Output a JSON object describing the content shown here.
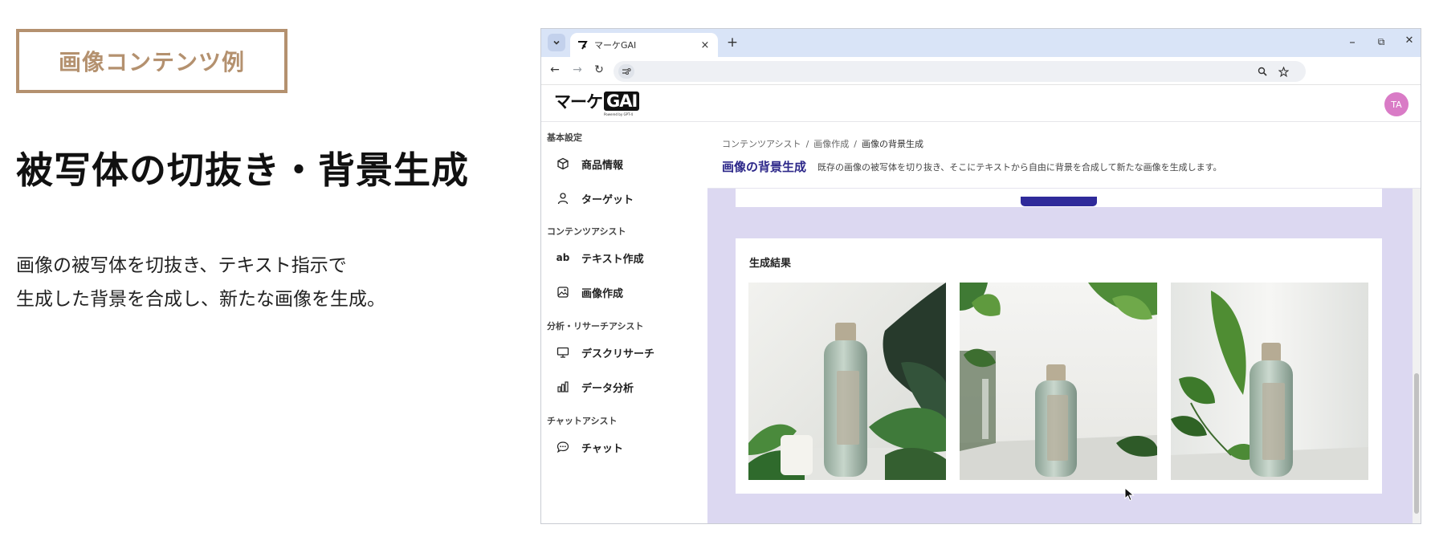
{
  "promo": {
    "badge": "画像コンテンツ例",
    "headline": "被写体の切抜き・背景生成",
    "description_lines": [
      "画像の被写体を切抜き、テキスト指示で",
      "生成した背景を合成し、新たな画像を生成。"
    ]
  },
  "browser": {
    "tab_title": "マーケGAI",
    "new_tab_label": "+",
    "tab_close_label": "×",
    "window_controls": {
      "minimize": "–",
      "restore": "⧉",
      "close": "✕"
    },
    "nav": {
      "back": "←",
      "forward": "→",
      "reload": "↻"
    }
  },
  "app": {
    "logo": {
      "kana": "マーケ",
      "gai": "GAI",
      "sub": "Powered by GPT-4"
    },
    "avatar": "TA",
    "sidebar": {
      "groups": [
        {
          "label": "基本設定",
          "items": [
            {
              "label": "商品情報",
              "icon": "cube-icon"
            },
            {
              "label": "ターゲット",
              "icon": "person-icon"
            }
          ]
        },
        {
          "label": "コンテンツアシスト",
          "items": [
            {
              "label": "テキスト作成",
              "icon": "text-ab-icon",
              "glyph": "ab"
            },
            {
              "label": "画像作成",
              "icon": "image-icon"
            }
          ]
        },
        {
          "label": "分析・リサーチアシスト",
          "items": [
            {
              "label": "デスクリサーチ",
              "icon": "monitor-icon"
            },
            {
              "label": "データ分析",
              "icon": "bar-chart-icon"
            }
          ]
        },
        {
          "label": "チャットアシスト",
          "items": [
            {
              "label": "チャット",
              "icon": "chat-bubble-icon"
            }
          ]
        }
      ]
    },
    "breadcrumb": {
      "items": [
        "コンテンツアシスト",
        "画像作成",
        "画像の背景生成"
      ],
      "separator": "/"
    },
    "page_title": "画像の背景生成",
    "page_description": "既存の画像の被写体を切り抜き、そこにテキストから自由に背景を合成して新たな画像を生成します。",
    "results": {
      "title": "生成結果",
      "image_count": 3
    },
    "colors": {
      "accent": "#2c2789",
      "content_bg": "#dcd8f1",
      "avatar": "#d97bc6",
      "badge": "#b4916f"
    }
  }
}
